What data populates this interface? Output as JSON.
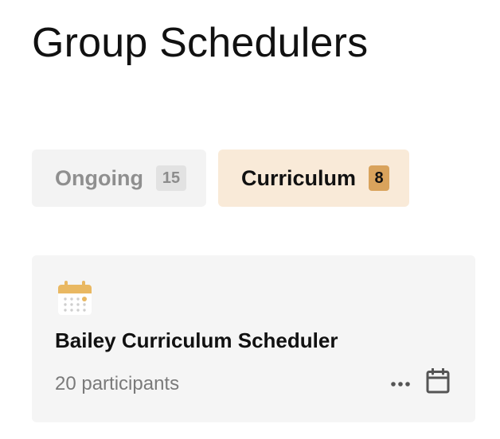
{
  "page": {
    "title": "Group Schedulers"
  },
  "tabs": [
    {
      "label": "Ongoing",
      "count": "15",
      "active": false
    },
    {
      "label": "Curriculum",
      "count": "8",
      "active": true
    }
  ],
  "card": {
    "icon": "calendar-icon",
    "title": "Bailey Curriculum Scheduler",
    "participants": "20 participants",
    "actions": [
      "more-icon",
      "calendar-icon"
    ]
  },
  "colors": {
    "active_tab_bg": "#f9ead8",
    "active_count_bg": "#d9a35c",
    "inactive_tab_bg": "#f3f3f3",
    "card_bg": "#f5f5f5",
    "accent_icon": "#e9b862",
    "muted_text": "#7a7a7a"
  }
}
